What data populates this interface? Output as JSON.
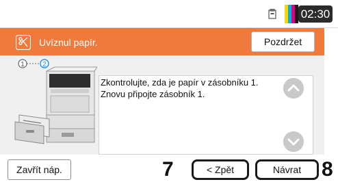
{
  "status": {
    "time": "02:30",
    "toner_colors": [
      "#ffd400",
      "#00aeef",
      "#e0007a",
      "#1a1a1a"
    ]
  },
  "header": {
    "icon": "paper-jam-icon",
    "title": "Uvíznul papír.",
    "postpone_label": "Pozdržet",
    "accent_color": "#f07a3c"
  },
  "steps": {
    "current": "2",
    "items": [
      "1",
      "2"
    ]
  },
  "main": {
    "illustration": "printer-tray-illustration",
    "message_line1": "Zkontrolujte, zda je papír v  zásobníku 1.",
    "message_line2": "Znovu připojte zásobník 1."
  },
  "footer": {
    "close_note_label": "Zavřít náp.",
    "back_label": "< Zpět",
    "return_label": "Návrat",
    "marker_back": "7",
    "marker_return": "8"
  }
}
